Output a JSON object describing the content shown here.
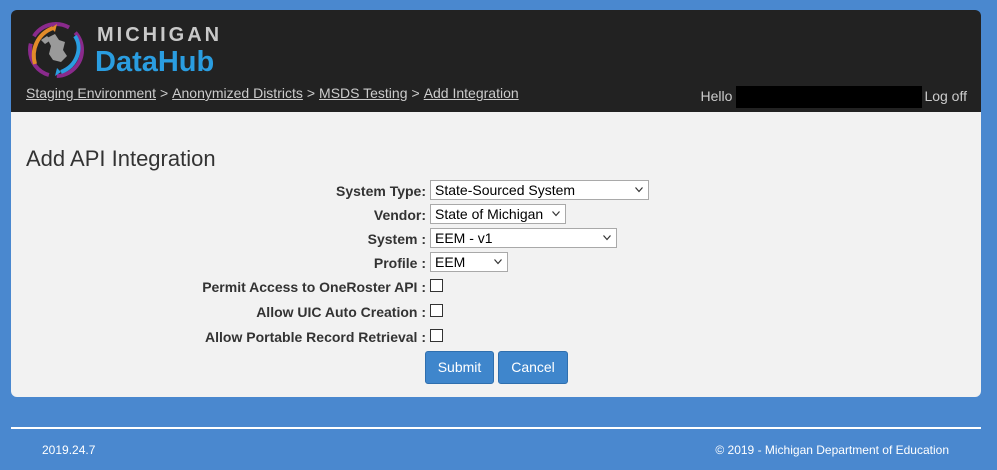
{
  "header": {
    "logo": {
      "top_text": "MICHIGAN",
      "main_text": "DataHub",
      "icon": "michigan-datahub-logo-icon"
    },
    "breadcrumb": [
      {
        "label": "Staging Environment"
      },
      {
        "label": "Anonymized Districts"
      },
      {
        "label": "MSDS Testing"
      },
      {
        "label": "Add Integration"
      }
    ],
    "breadcrumb_separator": ">",
    "greeting": "Hello",
    "logoff": "Log off"
  },
  "form": {
    "title": "Add API Integration",
    "fields": {
      "system_type": {
        "label": "System Type:",
        "value": "State-Sourced System"
      },
      "vendor": {
        "label": "Vendor:",
        "value": "State of Michigan"
      },
      "system": {
        "label": "System :",
        "value": "EEM - v1"
      },
      "profile": {
        "label": "Profile :",
        "value": "EEM"
      },
      "permit_oneroster": {
        "label": "Permit Access to OneRoster API :",
        "checked": false
      },
      "allow_uic": {
        "label": "Allow UIC Auto Creation :",
        "checked": false
      },
      "allow_portable": {
        "label": "Allow Portable Record Retrieval :",
        "checked": false
      }
    },
    "submit_label": "Submit",
    "cancel_label": "Cancel"
  },
  "footer": {
    "version": "2019.24.7",
    "copyright": "© 2019 - Michigan Department of Education"
  },
  "colors": {
    "page_background": "#4a88cf",
    "header_background": "#222222",
    "content_background": "#f2f2f2",
    "button": "#3f86cc",
    "logo_blue": "#2a9de0"
  }
}
